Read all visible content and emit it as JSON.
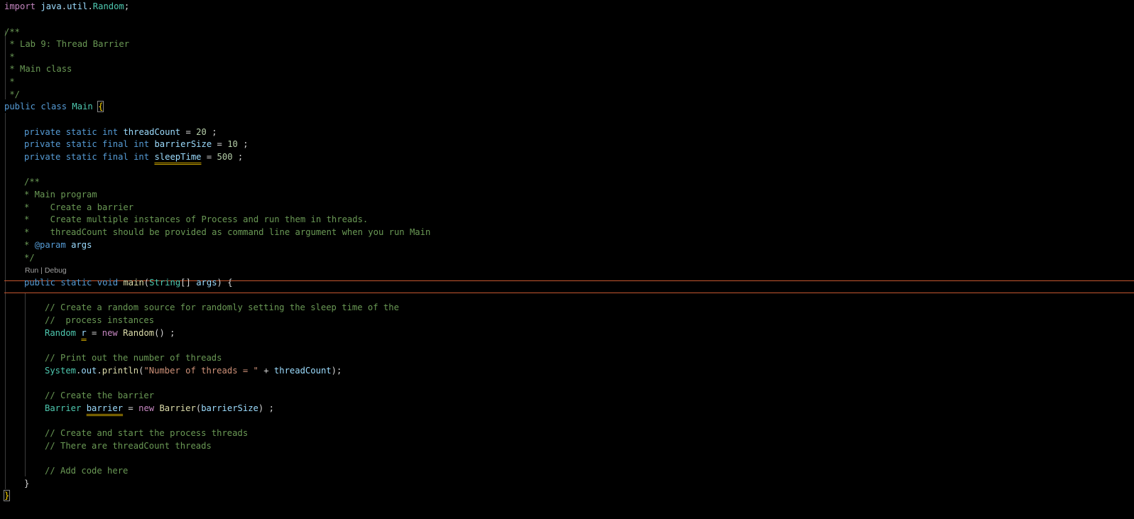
{
  "colors": {
    "background": "#000000",
    "keyword": "#569cd6",
    "control": "#c586c0",
    "type": "#4ec9b0",
    "variable": "#9cdcfe",
    "function": "#dcdcaa",
    "number": "#b5cea8",
    "string": "#ce9178",
    "comment": "#6a9955",
    "current_line_border": "#c5572f",
    "warning_squiggle": "#c8a200"
  },
  "code": {
    "import_kw": "import",
    "import_pkg1": "java",
    "import_pkg2": "util",
    "import_cls": "Random",
    "doc1": "/**",
    "doc2": " * Lab 9: Thread Barrier",
    "doc3": " *",
    "doc4": " * Main class",
    "doc5": " *",
    "doc6": " */",
    "class_mods": "public class",
    "class_name": "Main",
    "open_brace": "{",
    "f1_mods": "private static",
    "f1_type": "int",
    "f1_name": "threadCount",
    "f1_value": "20",
    "f2_mods": "private static final",
    "f2_type": "int",
    "f2_name": "barrierSize",
    "f2_value": "10",
    "f3_mods": "private static final",
    "f3_type": "int",
    "f3_name": "sleepTime",
    "f3_value": "500",
    "mdoc1": "/**",
    "mdoc2": "* Main program",
    "mdoc3": "*    Create a barrier",
    "mdoc4": "*    Create multiple instances of Process and run them in threads.",
    "mdoc5": "*    threadCount should be provided as command line argument when you run Main",
    "mdoc6_star": "*",
    "mdoc6_tag": "@param",
    "mdoc6_name": "args",
    "mdoc7": "*/",
    "main_mods": "public static",
    "main_void": "void",
    "main_name": "main",
    "main_ptype": "String",
    "main_param": "args",
    "c1": "// Create a random source for randomly setting the sleep time of the",
    "c2": "//  process instances",
    "r_type": "Random",
    "r_name": "r",
    "new_kw": "new",
    "r_ctor": "Random",
    "c3": "// Print out the number of threads",
    "sys": "System",
    "out": "out",
    "println": "println",
    "str1": "\"Number of threads = \"",
    "tc": "threadCount",
    "c4": "// Create the barrier",
    "b_type": "Barrier",
    "b_name": "barrier",
    "b_ctor": "Barrier",
    "b_arg": "barrierSize",
    "c5": "// Create and start the process threads",
    "c6": "// There are threadCount threads",
    "c7": "// Add code here",
    "close_method": "}",
    "close_class": "}"
  },
  "codelens": {
    "run": "Run",
    "separator": " | ",
    "debug": "Debug"
  }
}
